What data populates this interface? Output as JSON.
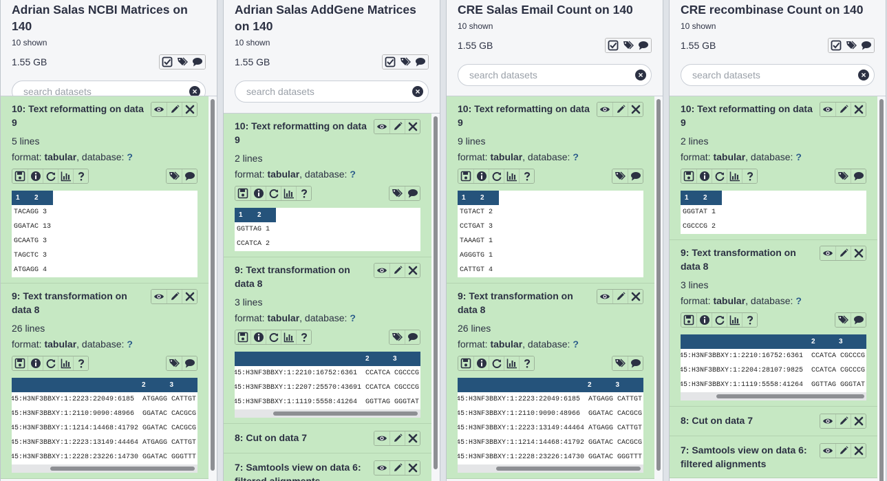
{
  "search_placeholder": "search datasets",
  "columns": [
    {
      "title": "Adrian Salas NCBI Matrices on 140",
      "shown": "10 shown",
      "size": "1.55 GB",
      "datasets": [
        {
          "title": "10: Text reformatting on data 9",
          "lines": "5 lines",
          "format_label": "format:",
          "format": "tabular",
          "database_label": ", database:",
          "database": "?",
          "peek_headers": [
            "1",
            "2"
          ],
          "peek_rows": [
            "TACAGG 3",
            "GGATAC 13",
            "GCAATG 3",
            "TAGCTC 3",
            "ATGAGG 4"
          ]
        },
        {
          "title": "9: Text transformation on data 8",
          "lines": "26 lines",
          "format_label": "format:",
          "format": "tabular",
          "database_label": ", database:",
          "database": "?",
          "peek_headers": [
            "2",
            "3"
          ],
          "peek_rows": [
            "45:H3NF3BBXY:1:2223:22049:6185  ATGAGG CATTGT",
            "45:H3NF3BBXY:1:2110:9090:48966  GGATAC CACGCG",
            "45:H3NF3BBXY:1:1214:14468:41792 GGATAC CACGCG",
            "45:H3NF3BBXY:1:2223:13149:44464 ATGAGG CATTGT",
            "45:H3NF3BBXY:1:2228:23226:14730 GGATAC GGGTTT"
          ]
        }
      ]
    },
    {
      "title": "Adrian Salas AddGene Matrices on 140",
      "shown": "10 shown",
      "size": "1.55 GB",
      "datasets": [
        {
          "title": "10: Text reformatting on data 9",
          "lines": "2 lines",
          "format_label": "format:",
          "format": "tabular",
          "database_label": ", database:",
          "database": "?",
          "peek_headers": [
            "1",
            "2"
          ],
          "peek_rows": [
            "GGTTAG 1",
            "CCATCA 2"
          ]
        },
        {
          "title": "9: Text transformation on data 8",
          "lines": "3 lines",
          "format_label": "format:",
          "format": "tabular",
          "database_label": ", database:",
          "database": "?",
          "peek_headers": [
            "2",
            "3"
          ],
          "peek_rows": [
            "45:H3NF3BBXY:1:2210:16752:6361  CCATCA CGCCCG",
            "45:H3NF3BBXY:1:2207:25570:43691 CCATCA CGCCCG",
            "45:H3NF3BBXY:1:1119:5558:41264  GGTTAG GGGTAT"
          ]
        }
      ],
      "collapsed": [
        "8: Cut on data 7",
        "7: Samtools view on data 6: filtered alignments"
      ]
    },
    {
      "title": "CRE Salas Email Count on 140",
      "shown": "10 shown",
      "size": "1.55 GB",
      "datasets": [
        {
          "title": "10: Text reformatting on data 9",
          "lines": "9 lines",
          "format_label": "format:",
          "format": "tabular",
          "database_label": ", database:",
          "database": "?",
          "peek_headers": [
            "1",
            "2"
          ],
          "peek_rows": [
            "TGTACT 2",
            "CCTGAT 3",
            "TAAAGT 1",
            "AGGGTG 1",
            "CATTGT 4"
          ]
        },
        {
          "title": "9: Text transformation on data 8",
          "lines": "26 lines",
          "format_label": "format:",
          "format": "tabular",
          "database_label": ", database:",
          "database": "?",
          "peek_headers": [
            "2",
            "3"
          ],
          "peek_rows": [
            "45:H3NF3BBXY:1:2223:22049:6185  ATGAGG CATTGT",
            "45:H3NF3BBXY:1:2110:9090:48966  GGATAC CACGCG",
            "45:H3NF3BBXY:1:2223:13149:44464 ATGAGG CATTGT",
            "45:H3NF3BBXY:1:1214:14468:41792 GGATAC CACGCG",
            "45:H3NF3BBXY:1:2228:23226:14730 GGATAC GGGTTT"
          ]
        }
      ]
    },
    {
      "title": "CRE recombinase Count on 140",
      "shown": "10 shown",
      "size": "1.55 GB",
      "datasets": [
        {
          "title": "10: Text reformatting on data 9",
          "lines": "2 lines",
          "format_label": "format:",
          "format": "tabular",
          "database_label": ", database:",
          "database": "?",
          "peek_headers": [
            "1",
            "2"
          ],
          "peek_rows": [
            "GGGTAT 1",
            "CGCCCG 2"
          ]
        },
        {
          "title": "9: Text transformation on data 8",
          "lines": "3 lines",
          "format_label": "format:",
          "format": "tabular",
          "database_label": ", database:",
          "database": "?",
          "peek_headers": [
            "2",
            "3"
          ],
          "peek_rows": [
            "45:H3NF3BBXY:1:2210:16752:6361  CCATCA CGCCCG",
            "45:H3NF3BBXY:1:2204:28107:9825  CCATCA CGCCCG",
            "45:H3NF3BBXY:1:1119:5558:41264  GGTTAG GGGTAT"
          ]
        }
      ],
      "collapsed": [
        "8: Cut on data 7",
        "7: Samtools view on data 6: filtered alignments"
      ]
    }
  ]
}
